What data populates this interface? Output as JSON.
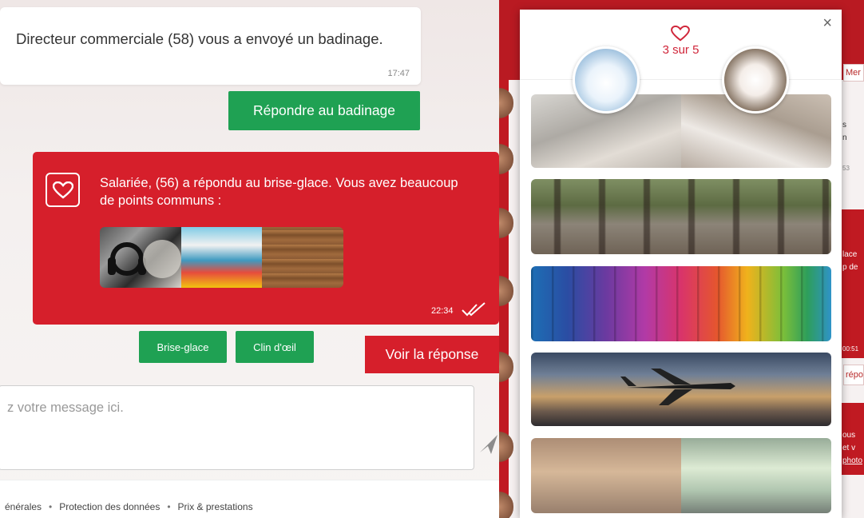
{
  "chat": {
    "incoming_message": "Directeur commerciale (58) vous a envoyé un badinage.",
    "incoming_time": "17:47",
    "reply_button": "Répondre au badinage",
    "icebreaker_message": "Salariée, (56) a répondu au brise-glace. Vous avez beaucoup de points communs :",
    "icebreaker_time": "22:34",
    "action_brise": "Brise-glace",
    "action_clin": "Clin d'œil",
    "voir_button": "Voir la réponse",
    "input_placeholder": "z votre message ici."
  },
  "footer": {
    "links": [
      "énérales",
      "Protection des données",
      "Prix & prestations"
    ]
  },
  "modal": {
    "close_label": "×",
    "count_text": "3 sur 5"
  },
  "background_edge": {
    "chip_label": "Mer",
    "chip_label_2": "répo",
    "line_1": "s",
    "line_2": "n",
    "line_3": "lace",
    "line_4": "p de",
    "line_5": "ous",
    "line_6": "et v",
    "line_7": "photo",
    "time_a": "53",
    "time_b": "00:51"
  },
  "colors": {
    "brand_red": "#d61f2b",
    "green": "#1fa153"
  }
}
